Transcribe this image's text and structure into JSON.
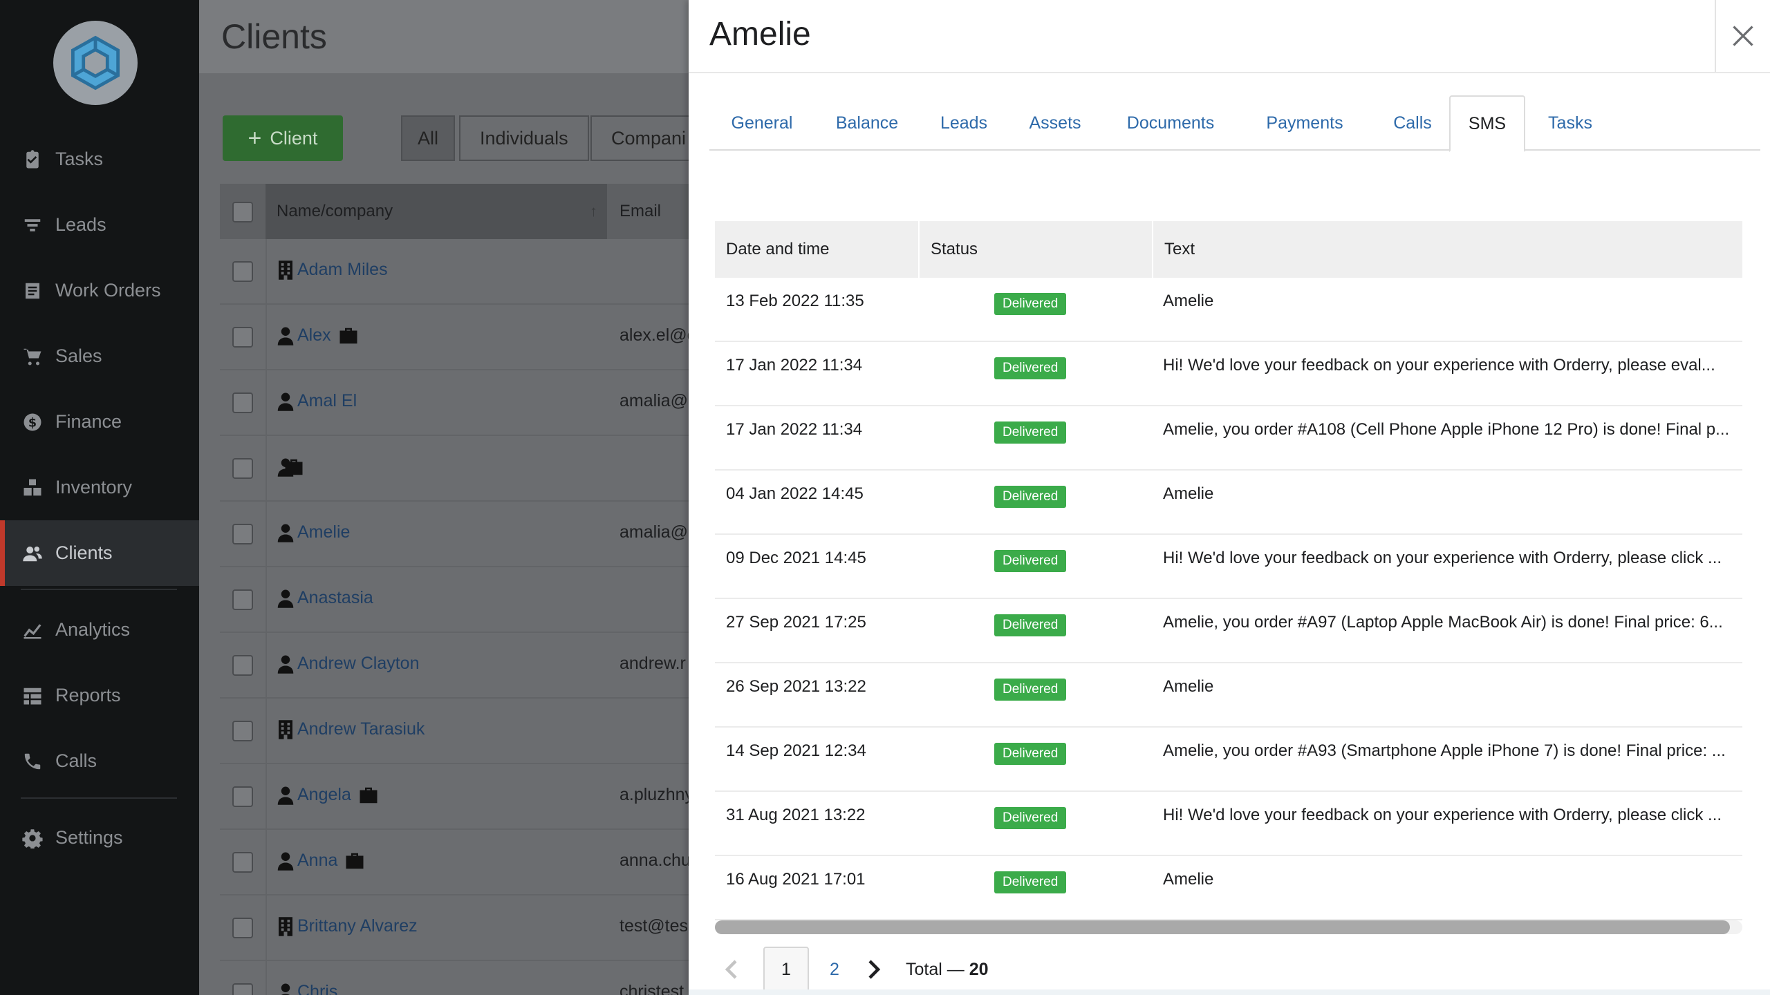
{
  "sidebar": {
    "logo_icon": "cube-logo-icon",
    "items": [
      {
        "label": "Tasks",
        "icon": "clipboard-icon"
      },
      {
        "label": "Leads",
        "icon": "funnel-icon"
      },
      {
        "label": "Work Orders",
        "icon": "document-icon"
      },
      {
        "label": "Sales",
        "icon": "cart-icon"
      },
      {
        "label": "Finance",
        "icon": "dollar-icon"
      },
      {
        "label": "Inventory",
        "icon": "boxes-icon"
      },
      {
        "label": "Clients",
        "icon": "users-icon",
        "active": true
      },
      {
        "label": "Analytics",
        "icon": "chart-icon"
      },
      {
        "label": "Reports",
        "icon": "list-icon"
      },
      {
        "label": "Calls",
        "icon": "phone-icon"
      },
      {
        "label": "Settings",
        "icon": "gear-icon"
      }
    ]
  },
  "clients_page": {
    "title": "Clients",
    "add_button": "Client",
    "filters": [
      "All",
      "Individuals",
      "Compani"
    ],
    "columns": {
      "name": "Name/company",
      "email": "Email"
    },
    "rows": [
      {
        "name": "Adam Miles",
        "type": "company",
        "briefcase": false,
        "email": ""
      },
      {
        "name": "Alex",
        "type": "person",
        "briefcase": true,
        "email": "alex.el@c"
      },
      {
        "name": "Amal El",
        "type": "person",
        "briefcase": false,
        "email": "amalia@c"
      },
      {
        "name": "",
        "type": "person",
        "briefcase": true,
        "email": ""
      },
      {
        "name": "Amelie",
        "type": "person",
        "briefcase": false,
        "email": "amalia@c"
      },
      {
        "name": "Anastasia",
        "type": "person",
        "briefcase": false,
        "email": ""
      },
      {
        "name": "Andrew Clayton",
        "type": "person",
        "briefcase": false,
        "email": "andrew.r"
      },
      {
        "name": "Andrew Tarasiuk",
        "type": "company",
        "briefcase": false,
        "email": ""
      },
      {
        "name": "Angela",
        "type": "person",
        "briefcase": true,
        "email": "a.pluzhny"
      },
      {
        "name": "Anna",
        "type": "person",
        "briefcase": true,
        "email": "anna.chu"
      },
      {
        "name": "Brittany Alvarez",
        "type": "company",
        "briefcase": false,
        "email": "test@tes"
      },
      {
        "name": "Chris",
        "type": "person",
        "briefcase": false,
        "email": "christest"
      }
    ]
  },
  "panel": {
    "title": "Amelie",
    "close_icon": "close-icon",
    "tabs": [
      "General",
      "Balance",
      "Leads",
      "Assets",
      "Documents",
      "Payments",
      "Calls",
      "SMS",
      "Tasks"
    ],
    "active_tab": "SMS",
    "sms_columns": {
      "date": "Date and time",
      "status": "Status",
      "text": "Text"
    },
    "sms_rows": [
      {
        "date": "13 Feb 2022 11:35",
        "status": "Delivered",
        "text": "Amelie"
      },
      {
        "date": "17 Jan 2022 11:34",
        "status": "Delivered",
        "text": "Hi! We'd love your feedback on your experience with Orderry, please eval..."
      },
      {
        "date": "17 Jan 2022 11:34",
        "status": "Delivered",
        "text": "Amelie, you order #A108 (Cell Phone Apple iPhone 12 Pro) is done! Final p..."
      },
      {
        "date": "04 Jan 2022 14:45",
        "status": "Delivered",
        "text": "Amelie"
      },
      {
        "date": "09 Dec 2021 14:45",
        "status": "Delivered",
        "text": "Hi! We'd love your feedback on your experience with Orderry, please click ..."
      },
      {
        "date": "27 Sep 2021 17:25",
        "status": "Delivered",
        "text": "Amelie, you order #A97 (Laptop Apple MacBook Air) is done! Final price: 6..."
      },
      {
        "date": "26 Sep 2021 13:22",
        "status": "Delivered",
        "text": "Amelie"
      },
      {
        "date": "14 Sep 2021 12:34",
        "status": "Delivered",
        "text": "Amelie, you order #A93 (Smartphone Apple iPhone 7) is done! Final price: ..."
      },
      {
        "date": "31 Aug 2021 13:22",
        "status": "Delivered",
        "text": "Hi! We'd love your feedback on your experience with Orderry, please click ..."
      },
      {
        "date": "16 Aug 2021 17:01",
        "status": "Delivered",
        "text": "Amelie"
      }
    ],
    "pagination": {
      "pages": [
        "1",
        "2"
      ],
      "current": "1",
      "total_label": "Total —",
      "total_value": "20"
    }
  },
  "colors": {
    "sidebar_bg": "#131516",
    "active_marker": "#c0392b",
    "link": "#2e6aaa",
    "delivered_badge": "#3bab4a",
    "add_button": "#2f6b30"
  }
}
